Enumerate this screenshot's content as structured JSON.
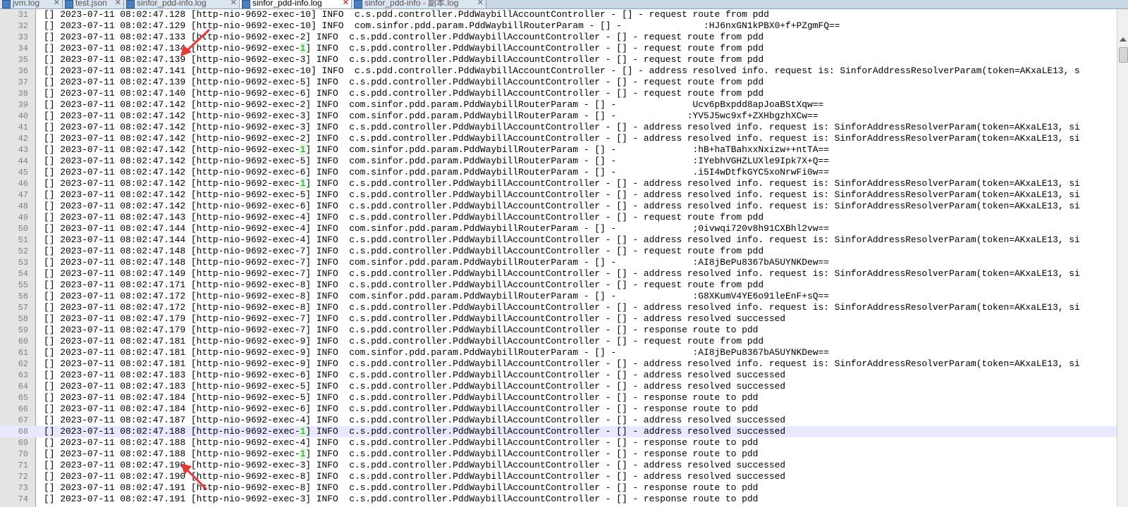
{
  "tabs": [
    {
      "label": "jvm.log",
      "active": false
    },
    {
      "label": "test.json",
      "active": false
    },
    {
      "label": "sinfor_pdd-info.log",
      "active": false
    },
    {
      "label": "sinfor_pdd-info.log",
      "active": true
    },
    {
      "label": "sinfor_pdd-info - 副本.log",
      "active": false
    }
  ],
  "editor": {
    "current_line": 68,
    "lines": [
      {
        "num": "31",
        "text": "[] 2023-07-11 08:02:47.128 [http-nio-9692-exec-10] INFO  c.s.pdd.controller.PddWaybillAccountController - [] - request route from pdd"
      },
      {
        "num": "32",
        "text": "[] 2023-07-11 08:02:47.129 [http-nio-9692-exec-10] INFO  com.sinfor.pdd.param.PddWaybillRouterParam - [] -               :HJ6nxGN1kPBX0+f+PZgmFQ=="
      },
      {
        "num": "33",
        "text": "[] 2023-07-11 08:02:47.133 [http-nio-9692-exec-2] INFO  c.s.pdd.controller.PddWaybillAccountController - [] - request route from pdd"
      },
      {
        "num": "34",
        "pre": "[] 2023-07-11 08:02:47.134 [http-nio-9692-exec-",
        "hl": "1",
        "post": "] INFO  c.s.pdd.controller.PddWaybillAccountController - [] - request route from pdd"
      },
      {
        "num": "35",
        "text": "[] 2023-07-11 08:02:47.139 [http-nio-9692-exec-3] INFO  c.s.pdd.controller.PddWaybillAccountController - [] - request route from pdd"
      },
      {
        "num": "36",
        "text": "[] 2023-07-11 08:02:47.141 [http-nio-9692-exec-10] INFO  c.s.pdd.controller.PddWaybillAccountController - [] - address resolved info. request is: SinforAddressResolverParam(token=AKxaLE13, s"
      },
      {
        "num": "37",
        "text": "[] 2023-07-11 08:02:47.139 [http-nio-9692-exec-5] INFO  c.s.pdd.controller.PddWaybillAccountController - [] - request route from pdd"
      },
      {
        "num": "38",
        "text": "[] 2023-07-11 08:02:47.140 [http-nio-9692-exec-6] INFO  c.s.pdd.controller.PddWaybillAccountController - [] - request route from pdd"
      },
      {
        "num": "39",
        "text": "[] 2023-07-11 08:02:47.142 [http-nio-9692-exec-2] INFO  com.sinfor.pdd.param.PddWaybillRouterParam - [] -              Ucv6pBxpdd8apJoaBStXqw=="
      },
      {
        "num": "40",
        "text": "[] 2023-07-11 08:02:47.142 [http-nio-9692-exec-3] INFO  com.sinfor.pdd.param.PddWaybillRouterParam - [] -             :YV5J5wc9xf+ZXHbgzhXCw=="
      },
      {
        "num": "41",
        "text": "[] 2023-07-11 08:02:47.142 [http-nio-9692-exec-3] INFO  c.s.pdd.controller.PddWaybillAccountController - [] - address resolved info. request is: SinforAddressResolverParam(token=AKxaLE13, si"
      },
      {
        "num": "42",
        "text": "[] 2023-07-11 08:02:47.142 [http-nio-9692-exec-2] INFO  c.s.pdd.controller.PddWaybillAccountController - [] - address resolved info. request is: SinforAddressResolverParam(token=AKxaLE13, si"
      },
      {
        "num": "43",
        "pre": "[] 2023-07-11 08:02:47.142 [http-nio-9692-exec-",
        "hl": "1",
        "post": "] INFO  com.sinfor.pdd.param.PddWaybillRouterParam - [] -              :hB+haTBahxxNxizw++ntTA=="
      },
      {
        "num": "44",
        "text": "[] 2023-07-11 08:02:47.142 [http-nio-9692-exec-5] INFO  com.sinfor.pdd.param.PddWaybillRouterParam - [] -              :IYebhVGHZLUXle9Ipk7X+Q=="
      },
      {
        "num": "45",
        "text": "[] 2023-07-11 08:02:47.142 [http-nio-9692-exec-6] INFO  com.sinfor.pdd.param.PddWaybillRouterParam - [] -              .i5I4wDtfkGYC5xoNrwFi0w=="
      },
      {
        "num": "46",
        "pre": "[] 2023-07-11 08:02:47.142 [http-nio-9692-exec-",
        "hl": "1",
        "post": "] INFO  c.s.pdd.controller.PddWaybillAccountController - [] - address resolved info. request is: SinforAddressResolverParam(token=AKxaLE13, si"
      },
      {
        "num": "47",
        "text": "[] 2023-07-11 08:02:47.142 [http-nio-9692-exec-5] INFO  c.s.pdd.controller.PddWaybillAccountController - [] - address resolved info. request is: SinforAddressResolverParam(token=AKxaLE13, si"
      },
      {
        "num": "48",
        "text": "[] 2023-07-11 08:02:47.142 [http-nio-9692-exec-6] INFO  c.s.pdd.controller.PddWaybillAccountController - [] - address resolved info. request is: SinforAddressResolverParam(token=AKxaLE13, si"
      },
      {
        "num": "49",
        "text": "[] 2023-07-11 08:02:47.143 [http-nio-9692-exec-4] INFO  c.s.pdd.controller.PddWaybillAccountController - [] - request route from pdd"
      },
      {
        "num": "50",
        "text": "[] 2023-07-11 08:02:47.144 [http-nio-9692-exec-4] INFO  com.sinfor.pdd.param.PddWaybillRouterParam - [] -              ;0ivwqi720v8h91CXBhl2vw=="
      },
      {
        "num": "51",
        "text": "[] 2023-07-11 08:02:47.144 [http-nio-9692-exec-4] INFO  c.s.pdd.controller.PddWaybillAccountController - [] - address resolved info. request is: SinforAddressResolverParam(token=AKxaLE13, si"
      },
      {
        "num": "52",
        "text": "[] 2023-07-11 08:02:47.148 [http-nio-9692-exec-7] INFO  c.s.pdd.controller.PddWaybillAccountController - [] - request route from pdd"
      },
      {
        "num": "53",
        "text": "[] 2023-07-11 08:02:47.148 [http-nio-9692-exec-7] INFO  com.sinfor.pdd.param.PddWaybillRouterParam - [] -              :AI8jBePu8367bA5UYNKDew=="
      },
      {
        "num": "54",
        "text": "[] 2023-07-11 08:02:47.149 [http-nio-9692-exec-7] INFO  c.s.pdd.controller.PddWaybillAccountController - [] - address resolved info. request is: SinforAddressResolverParam(token=AKxaLE13, si"
      },
      {
        "num": "55",
        "text": "[] 2023-07-11 08:02:47.171 [http-nio-9692-exec-8] INFO  c.s.pdd.controller.PddWaybillAccountController - [] - request route from pdd"
      },
      {
        "num": "56",
        "text": "[] 2023-07-11 08:02:47.172 [http-nio-9692-exec-8] INFO  com.sinfor.pdd.param.PddWaybillRouterParam - [] -              :G8XKumV4YE6o91leEnF+sQ=="
      },
      {
        "num": "57",
        "text": "[] 2023-07-11 08:02:47.172 [http-nio-9692-exec-8] INFO  c.s.pdd.controller.PddWaybillAccountController - [] - address resolved info. request is: SinforAddressResolverParam(token=AKxaLE13, si"
      },
      {
        "num": "58",
        "text": "[] 2023-07-11 08:02:47.179 [http-nio-9692-exec-7] INFO  c.s.pdd.controller.PddWaybillAccountController - [] - address resolved successed"
      },
      {
        "num": "59",
        "text": "[] 2023-07-11 08:02:47.179 [http-nio-9692-exec-7] INFO  c.s.pdd.controller.PddWaybillAccountController - [] - response route to pdd"
      },
      {
        "num": "60",
        "text": "[] 2023-07-11 08:02:47.181 [http-nio-9692-exec-9] INFO  c.s.pdd.controller.PddWaybillAccountController - [] - request route from pdd"
      },
      {
        "num": "61",
        "text": "[] 2023-07-11 08:02:47.181 [http-nio-9692-exec-9] INFO  com.sinfor.pdd.param.PddWaybillRouterParam - [] -              :AI8jBePu8367bA5UYNKDew=="
      },
      {
        "num": "62",
        "text": "[] 2023-07-11 08:02:47.181 [http-nio-9692-exec-9] INFO  c.s.pdd.controller.PddWaybillAccountController - [] - address resolved info. request is: SinforAddressResolverParam(token=AKxaLE13, si"
      },
      {
        "num": "63",
        "text": "[] 2023-07-11 08:02:47.183 [http-nio-9692-exec-6] INFO  c.s.pdd.controller.PddWaybillAccountController - [] - address resolved successed"
      },
      {
        "num": "64",
        "text": "[] 2023-07-11 08:02:47.183 [http-nio-9692-exec-5] INFO  c.s.pdd.controller.PddWaybillAccountController - [] - address resolved successed"
      },
      {
        "num": "65",
        "text": "[] 2023-07-11 08:02:47.184 [http-nio-9692-exec-5] INFO  c.s.pdd.controller.PddWaybillAccountController - [] - response route to pdd"
      },
      {
        "num": "66",
        "text": "[] 2023-07-11 08:02:47.184 [http-nio-9692-exec-6] INFO  c.s.pdd.controller.PddWaybillAccountController - [] - response route to pdd"
      },
      {
        "num": "67",
        "text": "[] 2023-07-11 08:02:47.187 [http-nio-9692-exec-4] INFO  c.s.pdd.controller.PddWaybillAccountController - [] - address resolved successed"
      },
      {
        "num": "68",
        "pre": "[] 2023-07-11 08:02:47.188 [http-nio-9692-exec-",
        "hl": "1",
        "post": "] INFO  c.s.pdd.controller.PddWaybillAccountController - [] - address resolved successed"
      },
      {
        "num": "69",
        "text": "[] 2023-07-11 08:02:47.188 [http-nio-9692-exec-4] INFO  c.s.pdd.controller.PddWaybillAccountController - [] - response route to pdd"
      },
      {
        "num": "70",
        "pre": "[] 2023-07-11 08:02:47.188 [http-nio-9692-exec-",
        "hl": "1",
        "post": "] INFO  c.s.pdd.controller.PddWaybillAccountController - [] - response route to pdd"
      },
      {
        "num": "71",
        "text": "[] 2023-07-11 08:02:47.190 [http-nio-9692-exec-3] INFO  c.s.pdd.controller.PddWaybillAccountController - [] - address resolved successed"
      },
      {
        "num": "72",
        "text": "[] 2023-07-11 08:02:47.190 [http-nio-9692-exec-8] INFO  c.s.pdd.controller.PddWaybillAccountController - [] - address resolved successed"
      },
      {
        "num": "73",
        "text": "[] 2023-07-11 08:02:47.191 [http-nio-9692-exec-8] INFO  c.s.pdd.controller.PddWaybillAccountController - [] - response route to pdd"
      },
      {
        "num": "74",
        "text": "[] 2023-07-11 08:02:47.191 [http-nio-9692-exec-3] INFO  c.s.pdd.controller.PddWaybillAccountController - [] - response route to pdd"
      }
    ]
  },
  "colors": {
    "highlight_text": "#00a000",
    "arrow": "#e53935",
    "current_line_bg": "#e8e8ff"
  }
}
